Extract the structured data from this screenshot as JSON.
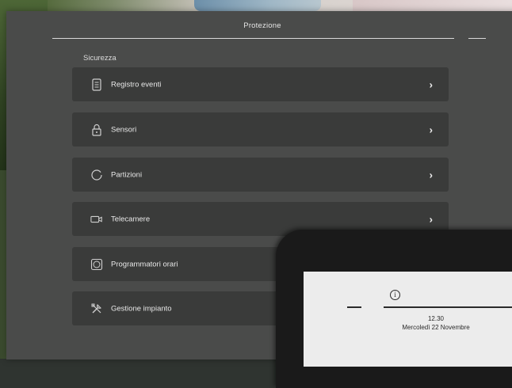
{
  "header": {
    "title": "Protezione"
  },
  "section": {
    "title": "Sicurezza"
  },
  "items": [
    {
      "label": "Registro eventi",
      "icon": "document-icon"
    },
    {
      "label": "Sensori",
      "icon": "lock-icon"
    },
    {
      "label": "Partizioni",
      "icon": "circle-icon"
    },
    {
      "label": "Telecamere",
      "icon": "camera-icon"
    },
    {
      "label": "Programmatori orari",
      "icon": "clock-icon"
    },
    {
      "label": "Gestione impianto",
      "icon": "tools-icon"
    }
  ],
  "device": {
    "time": "12.30",
    "date": "Mercoledì 22 Novembre"
  },
  "colors": {
    "panel_bg": "#4a4b4a",
    "item_bg": "#3a3b3a",
    "text": "#e8e8e8"
  }
}
